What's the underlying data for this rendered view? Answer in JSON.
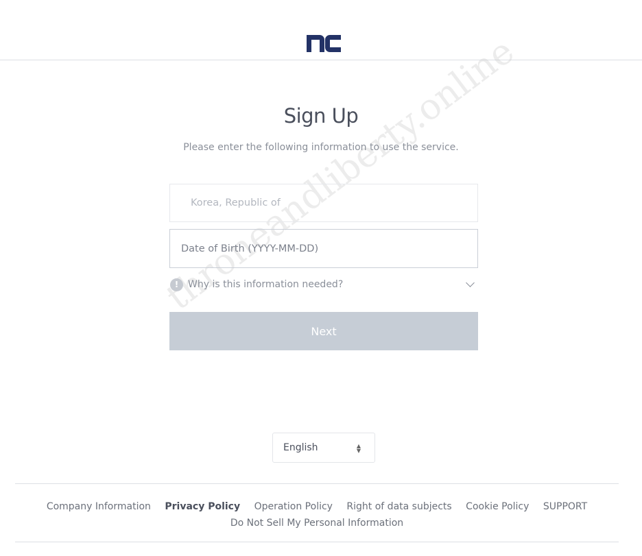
{
  "header": {
    "logo_text": "nc",
    "brand_color": "#233266"
  },
  "main": {
    "title": "Sign Up",
    "subtitle": "Please enter the following information to use the service.",
    "country_value": "Korea, Republic of",
    "dob_placeholder": "Date of Birth (YYYY-MM-DD)",
    "why_label": "Why is this information needed?",
    "next_label": "Next"
  },
  "watermark": "throneandliberty.online",
  "language": {
    "selected": "English"
  },
  "footer": {
    "links": [
      "Company Information",
      "Privacy Policy",
      "Operation Policy",
      "Right of data subjects",
      "Cookie Policy",
      "SUPPORT",
      "Do Not Sell My Personal Information"
    ]
  }
}
